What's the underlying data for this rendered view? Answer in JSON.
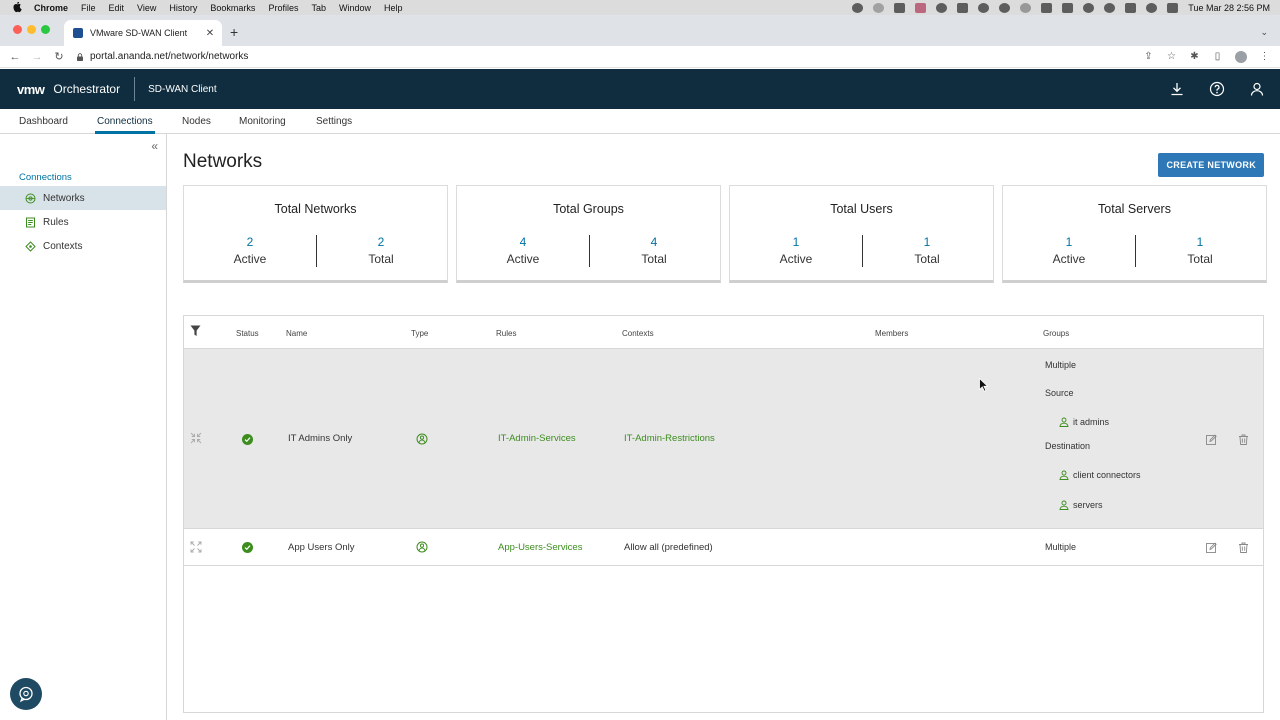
{
  "menubar": {
    "app": "Chrome",
    "items": [
      "File",
      "Edit",
      "View",
      "History",
      "Bookmarks",
      "Profiles",
      "Tab",
      "Window",
      "Help"
    ],
    "clock": "Tue Mar 28  2:56 PM"
  },
  "browser": {
    "tab_title": "VMware SD-WAN Client",
    "url": "portal.ananda.net/network/networks"
  },
  "header": {
    "logo": "vmw",
    "product": "Orchestrator",
    "app_name": "SD-WAN Client"
  },
  "topnav": {
    "tabs": [
      "Dashboard",
      "Connections",
      "Nodes",
      "Monitoring",
      "Settings"
    ],
    "active": "Connections"
  },
  "sidebar": {
    "section": "Connections",
    "items": [
      "Networks",
      "Rules",
      "Contexts"
    ],
    "active": "Networks"
  },
  "page": {
    "title": "Networks",
    "create_button": "CREATE NETWORK"
  },
  "stats": [
    {
      "title": "Total Networks",
      "active": "2",
      "active_label": "Active",
      "total": "2",
      "total_label": "Total"
    },
    {
      "title": "Total Groups",
      "active": "4",
      "active_label": "Active",
      "total": "4",
      "total_label": "Total"
    },
    {
      "title": "Total Users",
      "active": "1",
      "active_label": "Active",
      "total": "1",
      "total_label": "Total"
    },
    {
      "title": "Total Servers",
      "active": "1",
      "active_label": "Active",
      "total": "1",
      "total_label": "Total"
    }
  ],
  "table": {
    "columns": [
      "Status",
      "Name",
      "Type",
      "Rules",
      "Contexts",
      "Members",
      "Groups"
    ],
    "rows": [
      {
        "name": "IT Admins Only",
        "rules": "IT-Admin-Services",
        "contexts": "IT-Admin-Restrictions",
        "groups": {
          "summary": "Multiple",
          "source_label": "Source",
          "source": [
            "it admins"
          ],
          "destination_label": "Destination",
          "destination": [
            "client connectors",
            "servers"
          ]
        }
      },
      {
        "name": "App Users Only",
        "rules": "App-Users-Services",
        "contexts": "Allow all (predefined)",
        "groups": {
          "summary": "Multiple"
        }
      }
    ]
  },
  "colors": {
    "header_bg": "#0f2d3f",
    "accent_blue": "#0072a3",
    "button_blue": "#2e78b7",
    "green": "#3c8d1e",
    "sidebar_active": "#d8e3e9"
  }
}
